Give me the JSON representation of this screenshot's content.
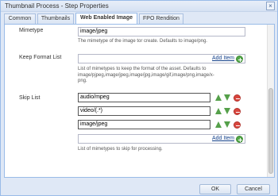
{
  "window": {
    "title": "Thumbnail Process - Step Properties",
    "close_glyph": "×"
  },
  "tabs": [
    {
      "label": "Common"
    },
    {
      "label": "Thumbnails"
    },
    {
      "label": "Web Enabled Image"
    },
    {
      "label": "FPO Rendition"
    }
  ],
  "active_tab": "Web Enabled Image",
  "mimetype": {
    "label": "Mimetype",
    "value": "image/jpeg",
    "help": "The mimetype of the image tor create. Defaults to image/png."
  },
  "keep_format": {
    "label": "Keep Format List",
    "add_item": "Add Item",
    "help_lines": [
      "List of mimetypes to keep the format of the asset. Defaults to",
      "image/pjpeg,image/jpeg,image/jpg,image/gif,image/png,image/x-",
      "png."
    ]
  },
  "skip_list": {
    "label": "Skip List",
    "items": [
      "audio/mpeg",
      "video/(.*)",
      "image/jpeg"
    ],
    "add_item": "Add Item",
    "help": "List of mimetypes to skip for processing."
  },
  "footer": {
    "ok": "OK",
    "cancel": "Cancel"
  },
  "icons": {
    "move_up": "arrow-up-icon",
    "move_down": "arrow-down-icon",
    "remove": "remove-icon",
    "add": "add-icon"
  },
  "colors": {
    "dialog_bg": "#dfe8f6",
    "border": "#99bbe8",
    "link": "#15428b",
    "add_green": "#54a849",
    "remove_red": "#d9463e"
  }
}
